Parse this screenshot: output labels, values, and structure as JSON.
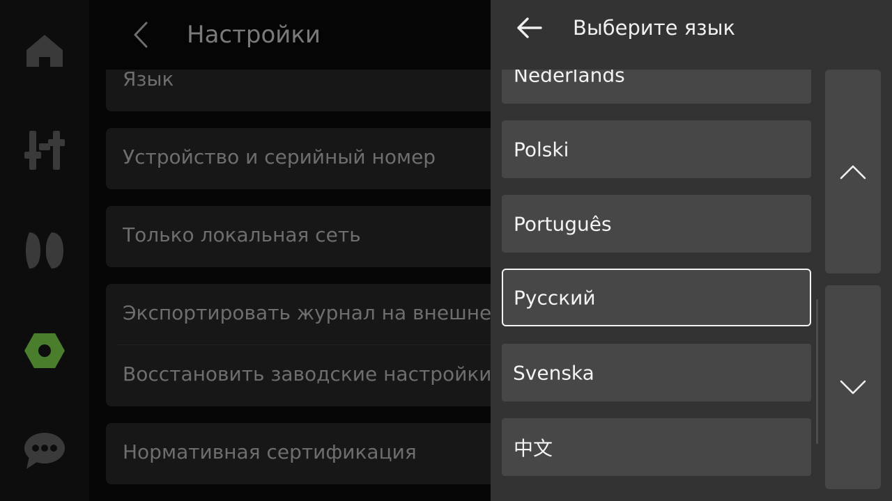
{
  "nav": {
    "items": [
      {
        "name": "home",
        "icon": "home-icon",
        "active": false
      },
      {
        "name": "controls",
        "icon": "sliders-icon",
        "active": false
      },
      {
        "name": "speakers",
        "icon": "speakers-icon",
        "active": false
      },
      {
        "name": "settings",
        "icon": "settings-icon",
        "active": true
      },
      {
        "name": "messages",
        "icon": "chat-icon",
        "active": false
      }
    ],
    "colors": {
      "icon": "#3a3a3a",
      "active": "#4a7d2c"
    }
  },
  "settings": {
    "back_icon": "chevron-left-icon",
    "title": "Настройки",
    "rows": {
      "language": "Язык",
      "device": "Устройство и серийный номер",
      "local_network": "Только локальная сеть",
      "export_log": "Экспортировать журнал на внешнее",
      "factory_reset": "Восстановить заводские настройки",
      "certification": "Нормативная сертификация"
    }
  },
  "language_picker": {
    "back_icon": "arrow-left-icon",
    "title": "Выберите язык",
    "languages": [
      {
        "label": "Nederlands",
        "selected": false
      },
      {
        "label": "Polski",
        "selected": false
      },
      {
        "label": "Português",
        "selected": false
      },
      {
        "label": "Русский",
        "selected": true
      },
      {
        "label": "Svenska",
        "selected": false
      },
      {
        "label": "中文",
        "selected": false
      }
    ],
    "page_up_icon": "chevron-up-icon",
    "page_down_icon": "chevron-down-icon"
  }
}
